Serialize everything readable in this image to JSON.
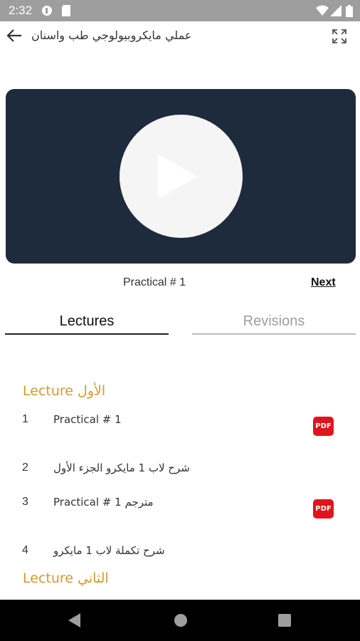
{
  "status_bar": {
    "time": "2:32",
    "icons": [
      "notification-circle-icon",
      "sd-card-icon",
      "wifi-icon",
      "signal-icon",
      "battery-icon"
    ]
  },
  "app_bar": {
    "title": "عملي مايكروبيولوجي طب واسنان",
    "back_icon": "arrow-left-icon",
    "fullscreen_icon": "fullscreen-icon"
  },
  "player": {
    "play_icon": "play-icon",
    "current_label": "Practical # 1",
    "next_label": "Next"
  },
  "tabs": [
    {
      "label": "Lectures",
      "active": true
    },
    {
      "label": "Revisions",
      "active": false
    }
  ],
  "sections": [
    {
      "title": "Lecture الأول",
      "items": [
        {
          "num": "1",
          "label": "Practical # 1",
          "pdf": true
        },
        {
          "num": "2",
          "label": "شرح لاب 1 مايكرو الجزء الأول",
          "pdf": false
        },
        {
          "num": "3",
          "label": "Practical # 1 مترجم",
          "pdf": true
        },
        {
          "num": "4",
          "label": "شرح تكملة لاب 1 مايكرو",
          "pdf": false
        }
      ]
    },
    {
      "title": "Lecture الثاني",
      "items": []
    }
  ],
  "pdf_badge_label": "PDF",
  "colors": {
    "player_bg": "#1e2b3d",
    "section_title": "#d39a2f",
    "pdf_red": "#e0141c",
    "status_bar": "#9e9e9e"
  }
}
